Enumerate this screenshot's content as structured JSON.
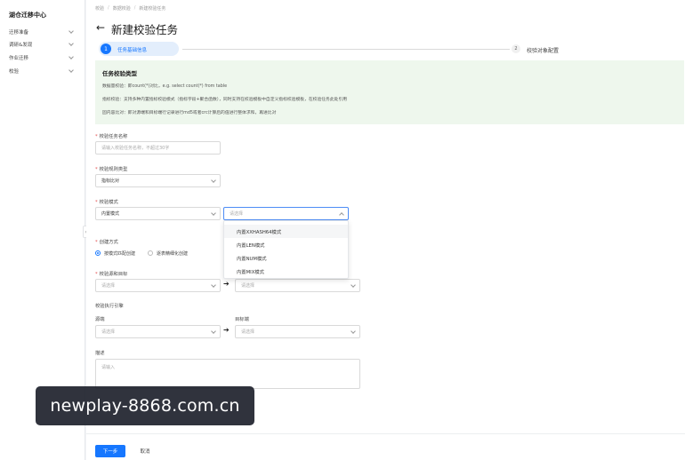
{
  "sidebar": {
    "title": "湖仓迁移中心",
    "items": [
      {
        "label": "迁移准备"
      },
      {
        "label": "调研&发现"
      },
      {
        "label": "作业迁移"
      },
      {
        "label": "校验"
      }
    ]
  },
  "breadcrumb": [
    "校验",
    "数据校验",
    "新建校验任务"
  ],
  "page": {
    "title": "新建校验任务"
  },
  "steps": [
    {
      "number": "1",
      "label": "任务基础信息"
    },
    {
      "number": "2",
      "label": "校验对象配置"
    }
  ],
  "info": {
    "title": "任务校验类型",
    "lines": [
      "数据量校验：即count(*)对比，e.g. select count(*) from table",
      "指标校验：支持多种内置指标校验模式（指标字段+聚合函数），同时支持在校验模板中自定义指标校验模板，在校验任务此处引用",
      "固内容比对：即对源端和目标端行记录进行md5或者crc计算后的值进行整体求和，再进比对"
    ]
  },
  "form": {
    "task_name": {
      "label": "校验任务名称",
      "placeholder": "请输入校验任务名称，不超过30字"
    },
    "rule_type": {
      "label": "校验规则类型",
      "value": "指标比对"
    },
    "check_mode": {
      "label": "校验模式",
      "value": "内置模式",
      "sub_placeholder": "请选择"
    },
    "dropdown_options": [
      "内置XXHASH64模式",
      "内置LEN模式",
      "内置NUM模式",
      "内置MIX模式"
    ],
    "create_method": {
      "label": "创建方式",
      "options": [
        "按模式匹配创建",
        "逐表精细化创建"
      ]
    },
    "source_target": {
      "label": "校验源和目标",
      "left_placeholder": "请选择",
      "right_placeholder": "请选择",
      "arrow": "➔"
    },
    "engine": {
      "label": "校验执行引擎",
      "source_label": "源端",
      "target_label": "目标端",
      "left_placeholder": "请选择",
      "right_placeholder": "请选择",
      "arrow": "➔"
    },
    "description": {
      "label": "描述",
      "placeholder": "请输入"
    }
  },
  "footer": {
    "next": "下一步",
    "cancel": "取消"
  },
  "watermark": "newplay-8868.com.cn",
  "colors": {
    "primary": "#1677ff",
    "info_bg": "#eef7ed"
  }
}
